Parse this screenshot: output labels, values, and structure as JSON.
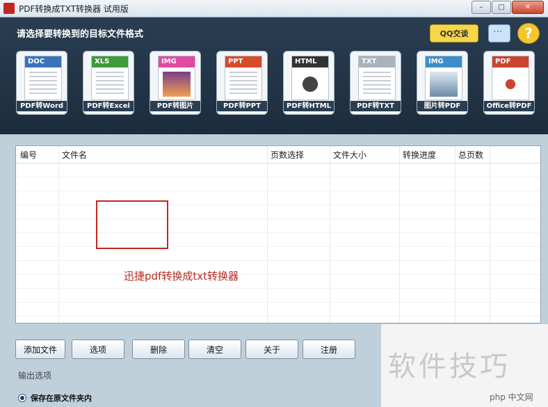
{
  "window": {
    "title": "PDF转换成TXT转换器 试用版",
    "controls": [
      "–",
      "□",
      "✕"
    ]
  },
  "header": {
    "prompt": "请选择要转换到的目标文件格式",
    "qq_button": "QQ交谈",
    "help_label": "?",
    "tiles": [
      {
        "band": "DOC",
        "label": "PDF转Word",
        "color": "#3b73b9"
      },
      {
        "band": "XLS",
        "label": "PDF转Excel",
        "color": "#3f9a3a"
      },
      {
        "band": "IMG",
        "label": "PDF转图片",
        "color": "#e04aa0"
      },
      {
        "band": "PPT",
        "label": "PDF转PPT",
        "color": "#d84a2a"
      },
      {
        "band": "HTML",
        "label": "PDF转HTML",
        "color": "#333333"
      },
      {
        "band": "TXT",
        "label": "PDF转TXT",
        "color": "#a9b3bd"
      },
      {
        "band": "IMG",
        "label": "图片转PDF",
        "color": "#3b8ec9"
      },
      {
        "band": "PDF",
        "label": "Office转PDF",
        "color": "#c9452f"
      }
    ]
  },
  "grid": {
    "columns": [
      "编号",
      "文件名",
      "页数选择",
      "文件大小",
      "转换进度",
      "总页数"
    ],
    "overlay_text": "迅捷pdf转换成txt转换器"
  },
  "buttons": [
    "添加文件",
    "选项",
    "删除",
    "清空",
    "关于",
    "注册"
  ],
  "output": {
    "title": "输出选项",
    "option": "保存在原文件夹内"
  },
  "watermark": {
    "big": "软件技巧",
    "small": "php 中文网"
  }
}
